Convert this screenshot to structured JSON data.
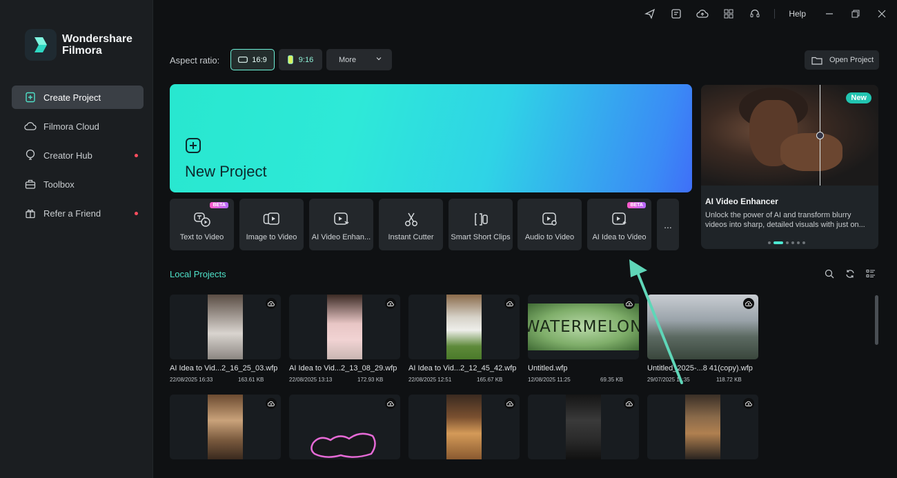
{
  "app": {
    "name_line1": "Wondershare",
    "name_line2": "Filmora"
  },
  "sidebar": {
    "items": [
      {
        "label": "Create Project",
        "icon": "create-project-icon"
      },
      {
        "label": "Filmora Cloud",
        "icon": "cloud-icon"
      },
      {
        "label": "Creator Hub",
        "icon": "bulb-icon"
      },
      {
        "label": "Toolbox",
        "icon": "toolbox-icon"
      },
      {
        "label": "Refer a Friend",
        "icon": "gift-icon"
      }
    ]
  },
  "titlebar": {
    "help": "Help"
  },
  "aspect": {
    "label": "Aspect ratio:",
    "r169": "16:9",
    "r916": "9:16",
    "more": "More"
  },
  "open_project": "Open Project",
  "new_project": {
    "title": "New Project"
  },
  "tools": [
    {
      "label": "Text to Video",
      "beta": "BETA"
    },
    {
      "label": "Image to Video"
    },
    {
      "label": "AI Video Enhan..."
    },
    {
      "label": "Instant Cutter"
    },
    {
      "label": "Smart Short Clips"
    },
    {
      "label": "Audio to Video"
    },
    {
      "label": "AI Idea to Video",
      "beta": "BETA"
    }
  ],
  "tools_more": "...",
  "promo": {
    "badge": "New",
    "title": "AI Video Enhancer",
    "desc": "Unlock the power of AI and transform blurry videos into sharp, detailed visuals with just on..."
  },
  "local": {
    "title": "Local Projects",
    "projects": [
      {
        "name": "AI Idea to Vid...2_16_25_03.wfp",
        "date": "22/08/2025 16:33",
        "size": "163.61 KB"
      },
      {
        "name": "AI Idea to Vid...2_13_08_29.wfp",
        "date": "22/08/2025 13:13",
        "size": "172.93 KB"
      },
      {
        "name": "AI Idea to Vid...2_12_45_42.wfp",
        "date": "22/08/2025 12:51",
        "size": "165.67 KB"
      },
      {
        "name": "Untitled.wfp",
        "date": "12/08/2025 11:25",
        "size": "69.35 KB"
      },
      {
        "name": "Untitled_2025-...8 41(copy).wfp",
        "date": "29/07/2025 11:35",
        "size": "118.72 KB"
      }
    ],
    "watermelon_text": "WATERMELON"
  },
  "colors": {
    "accent": "#4fe2c9",
    "sidebar_bg": "#1b1e21",
    "main_bg": "#0f1113",
    "arrow": "#5fd6b8"
  }
}
